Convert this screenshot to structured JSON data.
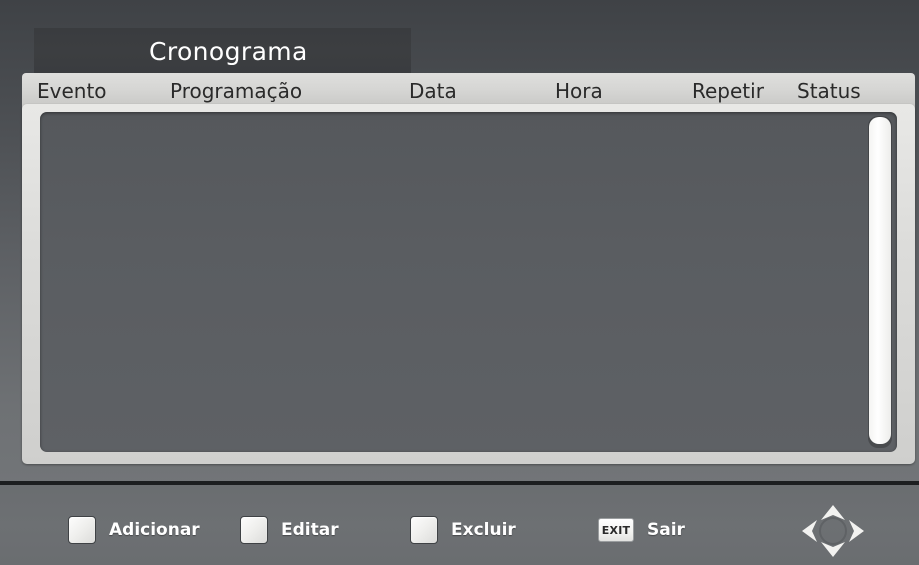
{
  "window": {
    "title": "Cronograma"
  },
  "table": {
    "columns": [
      {
        "key": "evento",
        "label": "Evento"
      },
      {
        "key": "programacao",
        "label": "Programação"
      },
      {
        "key": "data",
        "label": "Data"
      },
      {
        "key": "hora",
        "label": "Hora"
      },
      {
        "key": "repetir",
        "label": "Repetir"
      },
      {
        "key": "status",
        "label": "Status"
      }
    ],
    "rows": []
  },
  "scrollbar": {
    "orientation": "vertical",
    "thumb_position": "top",
    "thumb_fill_percent": 99
  },
  "toolbar": {
    "actions": [
      {
        "key": "adicionar",
        "icon": "color-key-square-icon",
        "label": "Adicionar"
      },
      {
        "key": "editar",
        "icon": "color-key-square-icon",
        "label": "Editar"
      },
      {
        "key": "excluir",
        "icon": "color-key-square-icon",
        "label": "Excluir"
      },
      {
        "key": "sair",
        "icon": "exit-key-icon",
        "key_text": "EXIT",
        "label": "Sair"
      }
    ],
    "dpad": {
      "icon": "dpad-navigation-icon",
      "directions": [
        "up",
        "right",
        "down",
        "left"
      ]
    }
  },
  "colors": {
    "background_top": "#3f4246",
    "background_bottom": "#76797c",
    "title_bar": "#3a3c3f",
    "title_text": "#ffffff",
    "header_strip": "#d6d6d4",
    "header_text": "#2a2a2a",
    "list_panel": "#5a5d61",
    "frame": "#dcdcda",
    "bottom_bar": "#6a6d70",
    "divider": "#1c1e20",
    "scrollbar_thumb": "#ffffff"
  }
}
